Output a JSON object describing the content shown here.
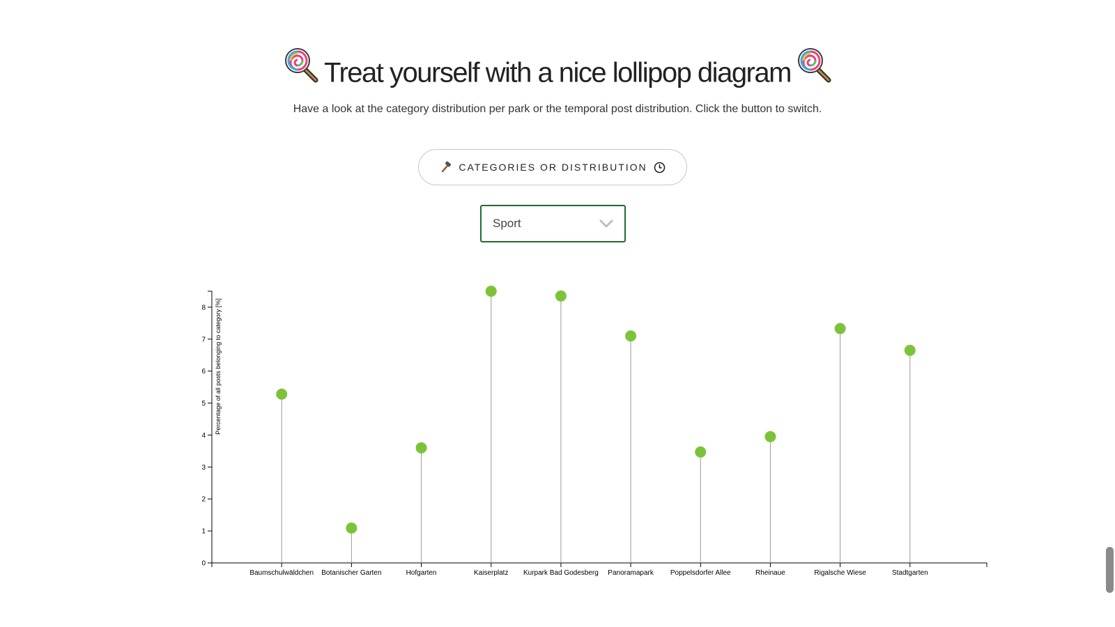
{
  "header": {
    "title": "Treat yourself with a nice lollipop diagram",
    "title_icon": "lollipop-icon",
    "subtitle": "Have a look at the category distribution per park or the temporal post distribution. Click the button to switch."
  },
  "toggle": {
    "label": "CATEGORIES OR DISTRIBUTION",
    "left_icon": "hammer-icon",
    "right_icon": "clock-icon"
  },
  "category_select": {
    "value": "Sport",
    "icon": "chevron-down-icon",
    "border_color": "#1f6b2c"
  },
  "colors": {
    "dot": "#7dc33a",
    "stem": "#999999",
    "axis": "#000000"
  },
  "chart_data": {
    "type": "lollipop",
    "ylabel": "Percentage of all posts belonging to category [%]",
    "xlabel": "",
    "ylim": [
      0,
      8.5
    ],
    "yticks": [
      0,
      1,
      2,
      3,
      4,
      5,
      6,
      7,
      8
    ],
    "grid": false,
    "categories": [
      "Baumschulwäldchen",
      "Botanischer Garten",
      "Hofgarten",
      "Kaiserplatz",
      "Kurpark Bad Godesberg",
      "Panoramapark",
      "Poppelsdorfer Allee",
      "Rheinaue",
      "Rigalsche Wiese",
      "Stadtgarten"
    ],
    "values": [
      5.28,
      1.09,
      3.6,
      8.5,
      8.35,
      7.1,
      3.47,
      3.95,
      7.33,
      6.65
    ]
  }
}
